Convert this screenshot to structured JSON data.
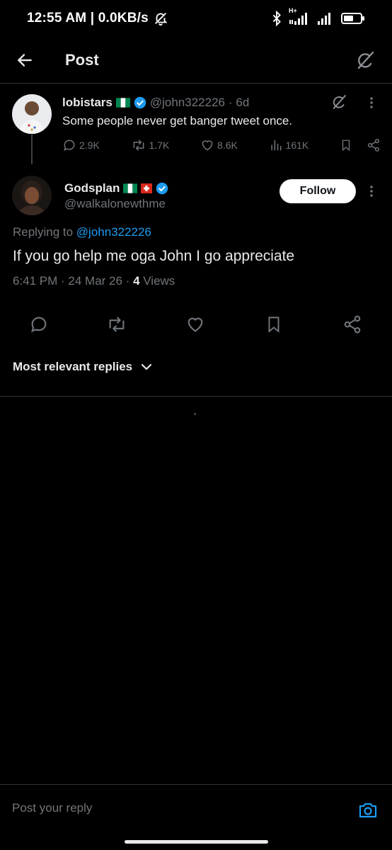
{
  "status_bar": {
    "time_speed": "12:55 AM | 0.0KB/s",
    "network_label": "H+",
    "icons": [
      "alarm-off-icon",
      "bluetooth-icon",
      "signal-icon",
      "signal-icon-2",
      "battery-icon"
    ]
  },
  "header": {
    "title": "Post",
    "icons": [
      "back-arrow-icon",
      "grok-icon"
    ]
  },
  "parent_tweet": {
    "name": "lobistars",
    "handle": "@john322226",
    "time": "· 6d",
    "text": "Some people never get banger tweet once.",
    "replies": "2.9K",
    "reposts": "1.7K",
    "likes": "8.6K",
    "views": "161K"
  },
  "main_tweet": {
    "name": "Godsplan",
    "handle": "@walkalonewthme",
    "follow_label": "Follow",
    "replying_prefix": "Replying to",
    "replying_handle": "@john322226",
    "text": "If you go help me oga John I go appreciate",
    "timestamp": "6:41 PM · 24 Mar 26 · ",
    "views_count": "4",
    "views_label": " Views"
  },
  "replies_sort": {
    "label": "Most relevant replies"
  },
  "reply_bar": {
    "placeholder": "Post your reply"
  },
  "colors": {
    "background": "#000000",
    "text": "#e7e9ea",
    "muted": "#71767b",
    "accent": "#1d9bf0",
    "divider": "#2f3336"
  }
}
